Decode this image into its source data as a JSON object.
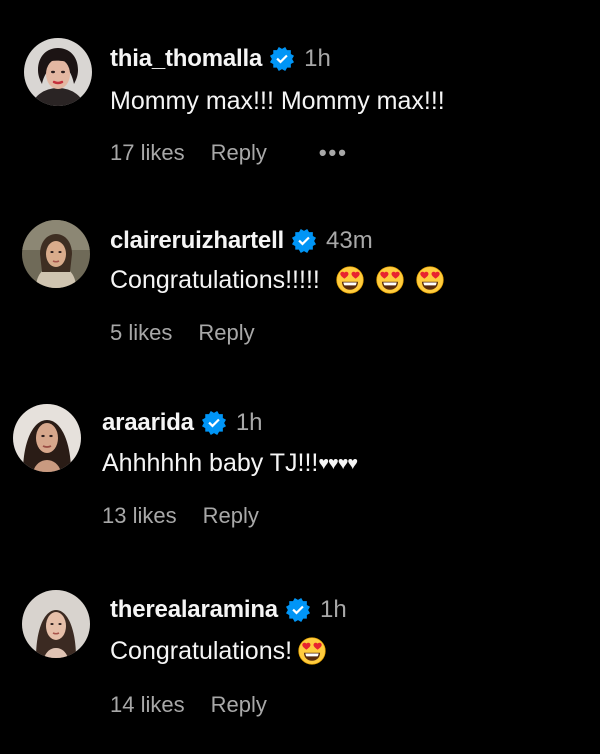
{
  "comments": [
    {
      "username": "thia_thomalla",
      "time": "1h",
      "text": "Mommy max!!! Mommy max!!!",
      "likes": "17 likes",
      "reply": "Reply",
      "more": "•••"
    },
    {
      "username": "claireruizhartell",
      "time": "43m",
      "text": "Congratulations!!!!!",
      "likes": "5 likes",
      "reply": "Reply"
    },
    {
      "username": "araarida",
      "time": "1h",
      "text": "Ahhhhhh baby TJ!!!",
      "hearts": "♥♥♥♥",
      "likes": "13 likes",
      "reply": "Reply"
    },
    {
      "username": "therealaramina",
      "time": "1h",
      "text": "Congratulations!",
      "likes": "14 likes",
      "reply": "Reply"
    }
  ],
  "icons": {
    "verified": "verified-badge-icon",
    "emoji": "heart-eyes-emoji-icon"
  },
  "colors": {
    "background": "#000000",
    "text": "#f5f5f5",
    "secondary": "#a8a8a8",
    "verified": "#0095f6"
  }
}
